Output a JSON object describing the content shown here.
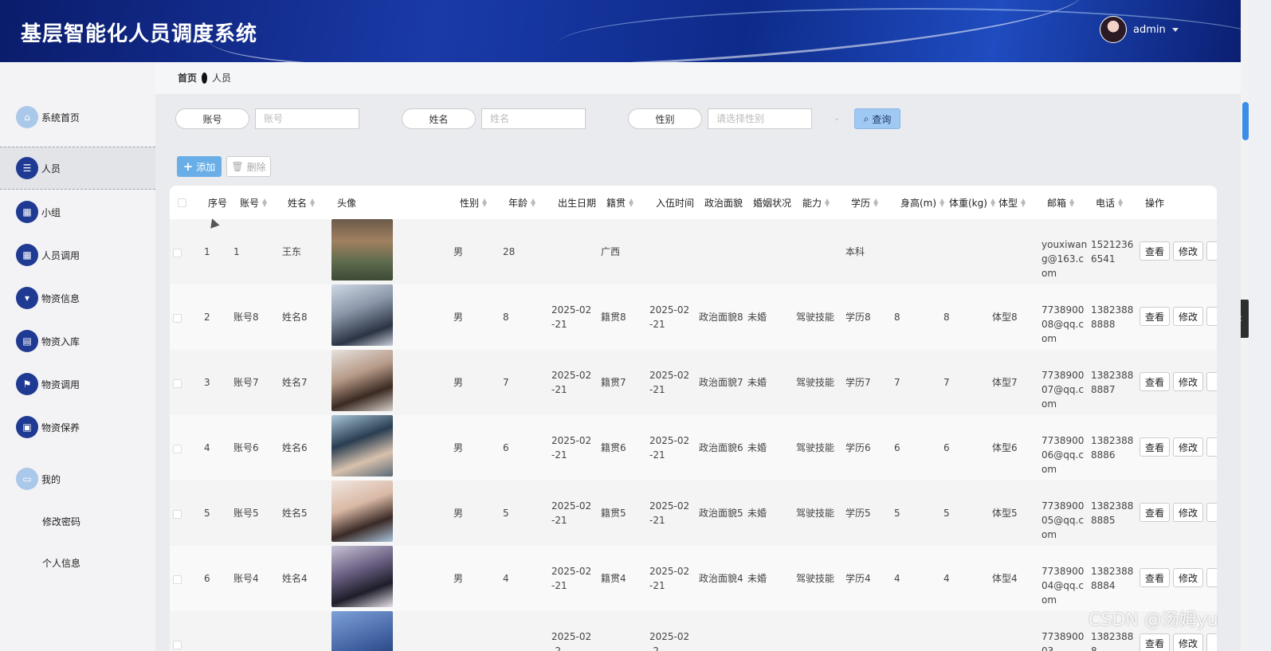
{
  "header": {
    "title": "基层智能化人员调度系统",
    "user": "admin"
  },
  "sidebar": {
    "items": [
      {
        "label": "系统首页",
        "icon": "home-icon"
      },
      {
        "label": "人员",
        "icon": "list-icon"
      },
      {
        "label": "小组",
        "icon": "grid-icon"
      },
      {
        "label": "人员调用",
        "icon": "grid-icon"
      },
      {
        "label": "物资信息",
        "icon": "brush-icon"
      },
      {
        "label": "物资入库",
        "icon": "clipboard-icon"
      },
      {
        "label": "物资调用",
        "icon": "flag-icon"
      },
      {
        "label": "物资保养",
        "icon": "briefcase-icon"
      },
      {
        "label": "我的",
        "icon": "card-icon"
      }
    ],
    "sub_items": [
      "修改密码",
      "个人信息"
    ]
  },
  "breadcrumb": {
    "home": "首页",
    "current": "人员"
  },
  "search": {
    "account_label": "账号",
    "account_placeholder": "账号",
    "name_label": "姓名",
    "name_placeholder": "姓名",
    "gender_label": "性别",
    "gender_placeholder": "请选择性别",
    "query_label": "查询"
  },
  "toolbar": {
    "add_label": "添加",
    "delete_label": "删除"
  },
  "table": {
    "headers": [
      "序号",
      "账号",
      "姓名",
      "头像",
      "性别",
      "年龄",
      "出生日期",
      "籍贯",
      "入伍时间",
      "政治面貌",
      "婚姻状况",
      "能力",
      "学历",
      "身高(m)",
      "体重(kg)",
      "体型",
      "邮箱",
      "电话",
      "操作"
    ],
    "rows": [
      {
        "no": "1",
        "account": "1",
        "name": "王东",
        "gender": "男",
        "age": "28",
        "birth": "",
        "native": "广西",
        "enlist": "",
        "political": "",
        "marital": "",
        "ability": "",
        "education": "本科",
        "height": "",
        "weight": "",
        "body": "",
        "email": "youxiwang@163.com",
        "phone": "15212366541"
      },
      {
        "no": "2",
        "account": "账号8",
        "name": "姓名8",
        "gender": "男",
        "age": "8",
        "birth": "2025-02-21",
        "native": "籍贯8",
        "enlist": "2025-02-21",
        "political": "政治面貌8",
        "marital": "未婚",
        "ability": "驾驶技能",
        "education": "学历8",
        "height": "8",
        "weight": "8",
        "body": "体型8",
        "email": "773890008@qq.com",
        "phone": "13823888888"
      },
      {
        "no": "3",
        "account": "账号7",
        "name": "姓名7",
        "gender": "男",
        "age": "7",
        "birth": "2025-02-21",
        "native": "籍贯7",
        "enlist": "2025-02-21",
        "political": "政治面貌7",
        "marital": "未婚",
        "ability": "驾驶技能",
        "education": "学历7",
        "height": "7",
        "weight": "7",
        "body": "体型7",
        "email": "773890007@qq.com",
        "phone": "13823888887"
      },
      {
        "no": "4",
        "account": "账号6",
        "name": "姓名6",
        "gender": "男",
        "age": "6",
        "birth": "2025-02-21",
        "native": "籍贯6",
        "enlist": "2025-02-21",
        "political": "政治面貌6",
        "marital": "未婚",
        "ability": "驾驶技能",
        "education": "学历6",
        "height": "6",
        "weight": "6",
        "body": "体型6",
        "email": "773890006@qq.com",
        "phone": "13823888886"
      },
      {
        "no": "5",
        "account": "账号5",
        "name": "姓名5",
        "gender": "男",
        "age": "5",
        "birth": "2025-02-21",
        "native": "籍贯5",
        "enlist": "2025-02-21",
        "political": "政治面貌5",
        "marital": "未婚",
        "ability": "驾驶技能",
        "education": "学历5",
        "height": "5",
        "weight": "5",
        "body": "体型5",
        "email": "773890005@qq.com",
        "phone": "13823888885"
      },
      {
        "no": "6",
        "account": "账号4",
        "name": "姓名4",
        "gender": "男",
        "age": "4",
        "birth": "2025-02-21",
        "native": "籍贯4",
        "enlist": "2025-02-21",
        "political": "政治面貌4",
        "marital": "未婚",
        "ability": "驾驶技能",
        "education": "学历4",
        "height": "4",
        "weight": "4",
        "body": "体型4",
        "email": "773890004@qq.com",
        "phone": "13823888884"
      },
      {
        "no": "",
        "account": "",
        "name": "",
        "gender": "",
        "age": "",
        "birth": "2025-02-2",
        "native": "",
        "enlist": "2025-02-2",
        "political": "",
        "marital": "",
        "ability": "",
        "education": "",
        "height": "",
        "weight": "",
        "body": "",
        "email": "773890003",
        "phone": "13823888"
      }
    ],
    "actions": {
      "view": "查看",
      "edit": "修改"
    }
  },
  "colors": {
    "header_dark": "#0a1c6b",
    "accent": "#1f3a93",
    "primary_button": "#6aaee8",
    "query_button": "#9fc8f2"
  },
  "watermark": "CSDN @汤姆yu"
}
